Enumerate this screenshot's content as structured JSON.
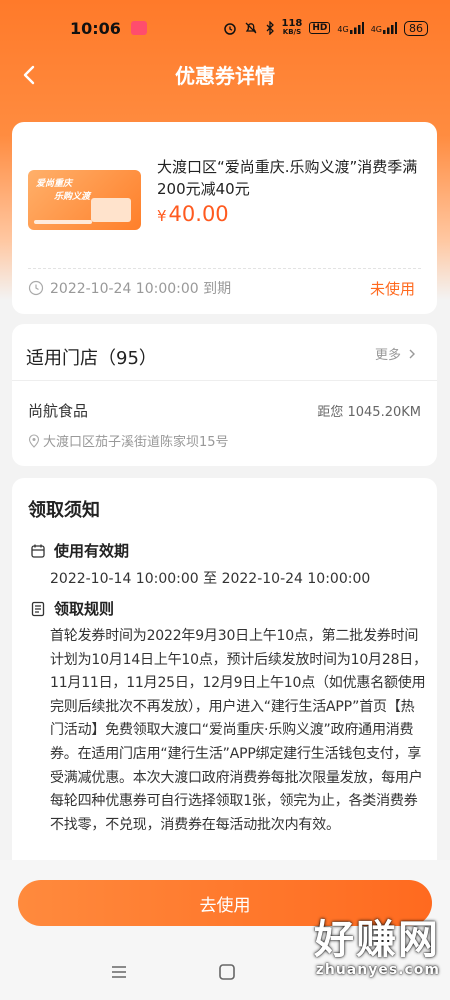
{
  "status_bar": {
    "time": "10:06",
    "net_speed_value": "118",
    "net_speed_unit": "KB/S",
    "hd_label": "HD",
    "signal_label_1": "4G",
    "signal_label_2": "4G",
    "battery": "86"
  },
  "header": {
    "title": "优惠券详情",
    "back_icon": "chevron-left-icon"
  },
  "coupon": {
    "image_text_1": "爱尚重庆",
    "image_text_2": "乐购义渡",
    "title": "大渡口区“爱尚重庆.乐购义渡”消费季满200元减40元",
    "currency": "¥",
    "price": "40.00",
    "expire_text": "2022-10-24 10:00:00 到期",
    "status": "未使用",
    "status_color": "#ff6a1f"
  },
  "stores": {
    "heading": "适用门店（95）",
    "more_label": "更多",
    "store_name": "尚航食品",
    "distance": "距您 1045.20KM",
    "address": "大渡口区茄子溪街道陈家坝15号"
  },
  "notice": {
    "heading": "领取须知",
    "validity_title": "使用有效期",
    "validity_text": "2022-10-14 10:00:00 至 2022-10-24 10:00:00",
    "rules_title": "领取规则",
    "rules_text": "首轮发券时间为2022年9月30日上午10点，第二批发券时间计划为10月14日上午10点，预计后续发放时间为10月28日，11月11日，11月25日，12月9日上午10点（如优惠名额使用完则后续批次不再发放），用户进入“建行生活APP”首页【热门活动】免费领取大渡口“爱尚重庆·乐购义渡”政府通用消费券。在适用门店用“建行生活”APP绑定建行生活钱包支付，享受满减优惠。本次大渡口政府消费券每批次限量发放，每用户每轮四种优惠券可自行选择领取1张，领完为止，各类消费券不找零，不兑现，消费券在每活动批次内有效。"
  },
  "action": {
    "use_button": "去使用"
  },
  "watermark": {
    "big": "好赚网",
    "small": "zhuanyes.com"
  },
  "colors": {
    "accent": "#ff6a1f",
    "header_bg": "#ff7a2a"
  }
}
